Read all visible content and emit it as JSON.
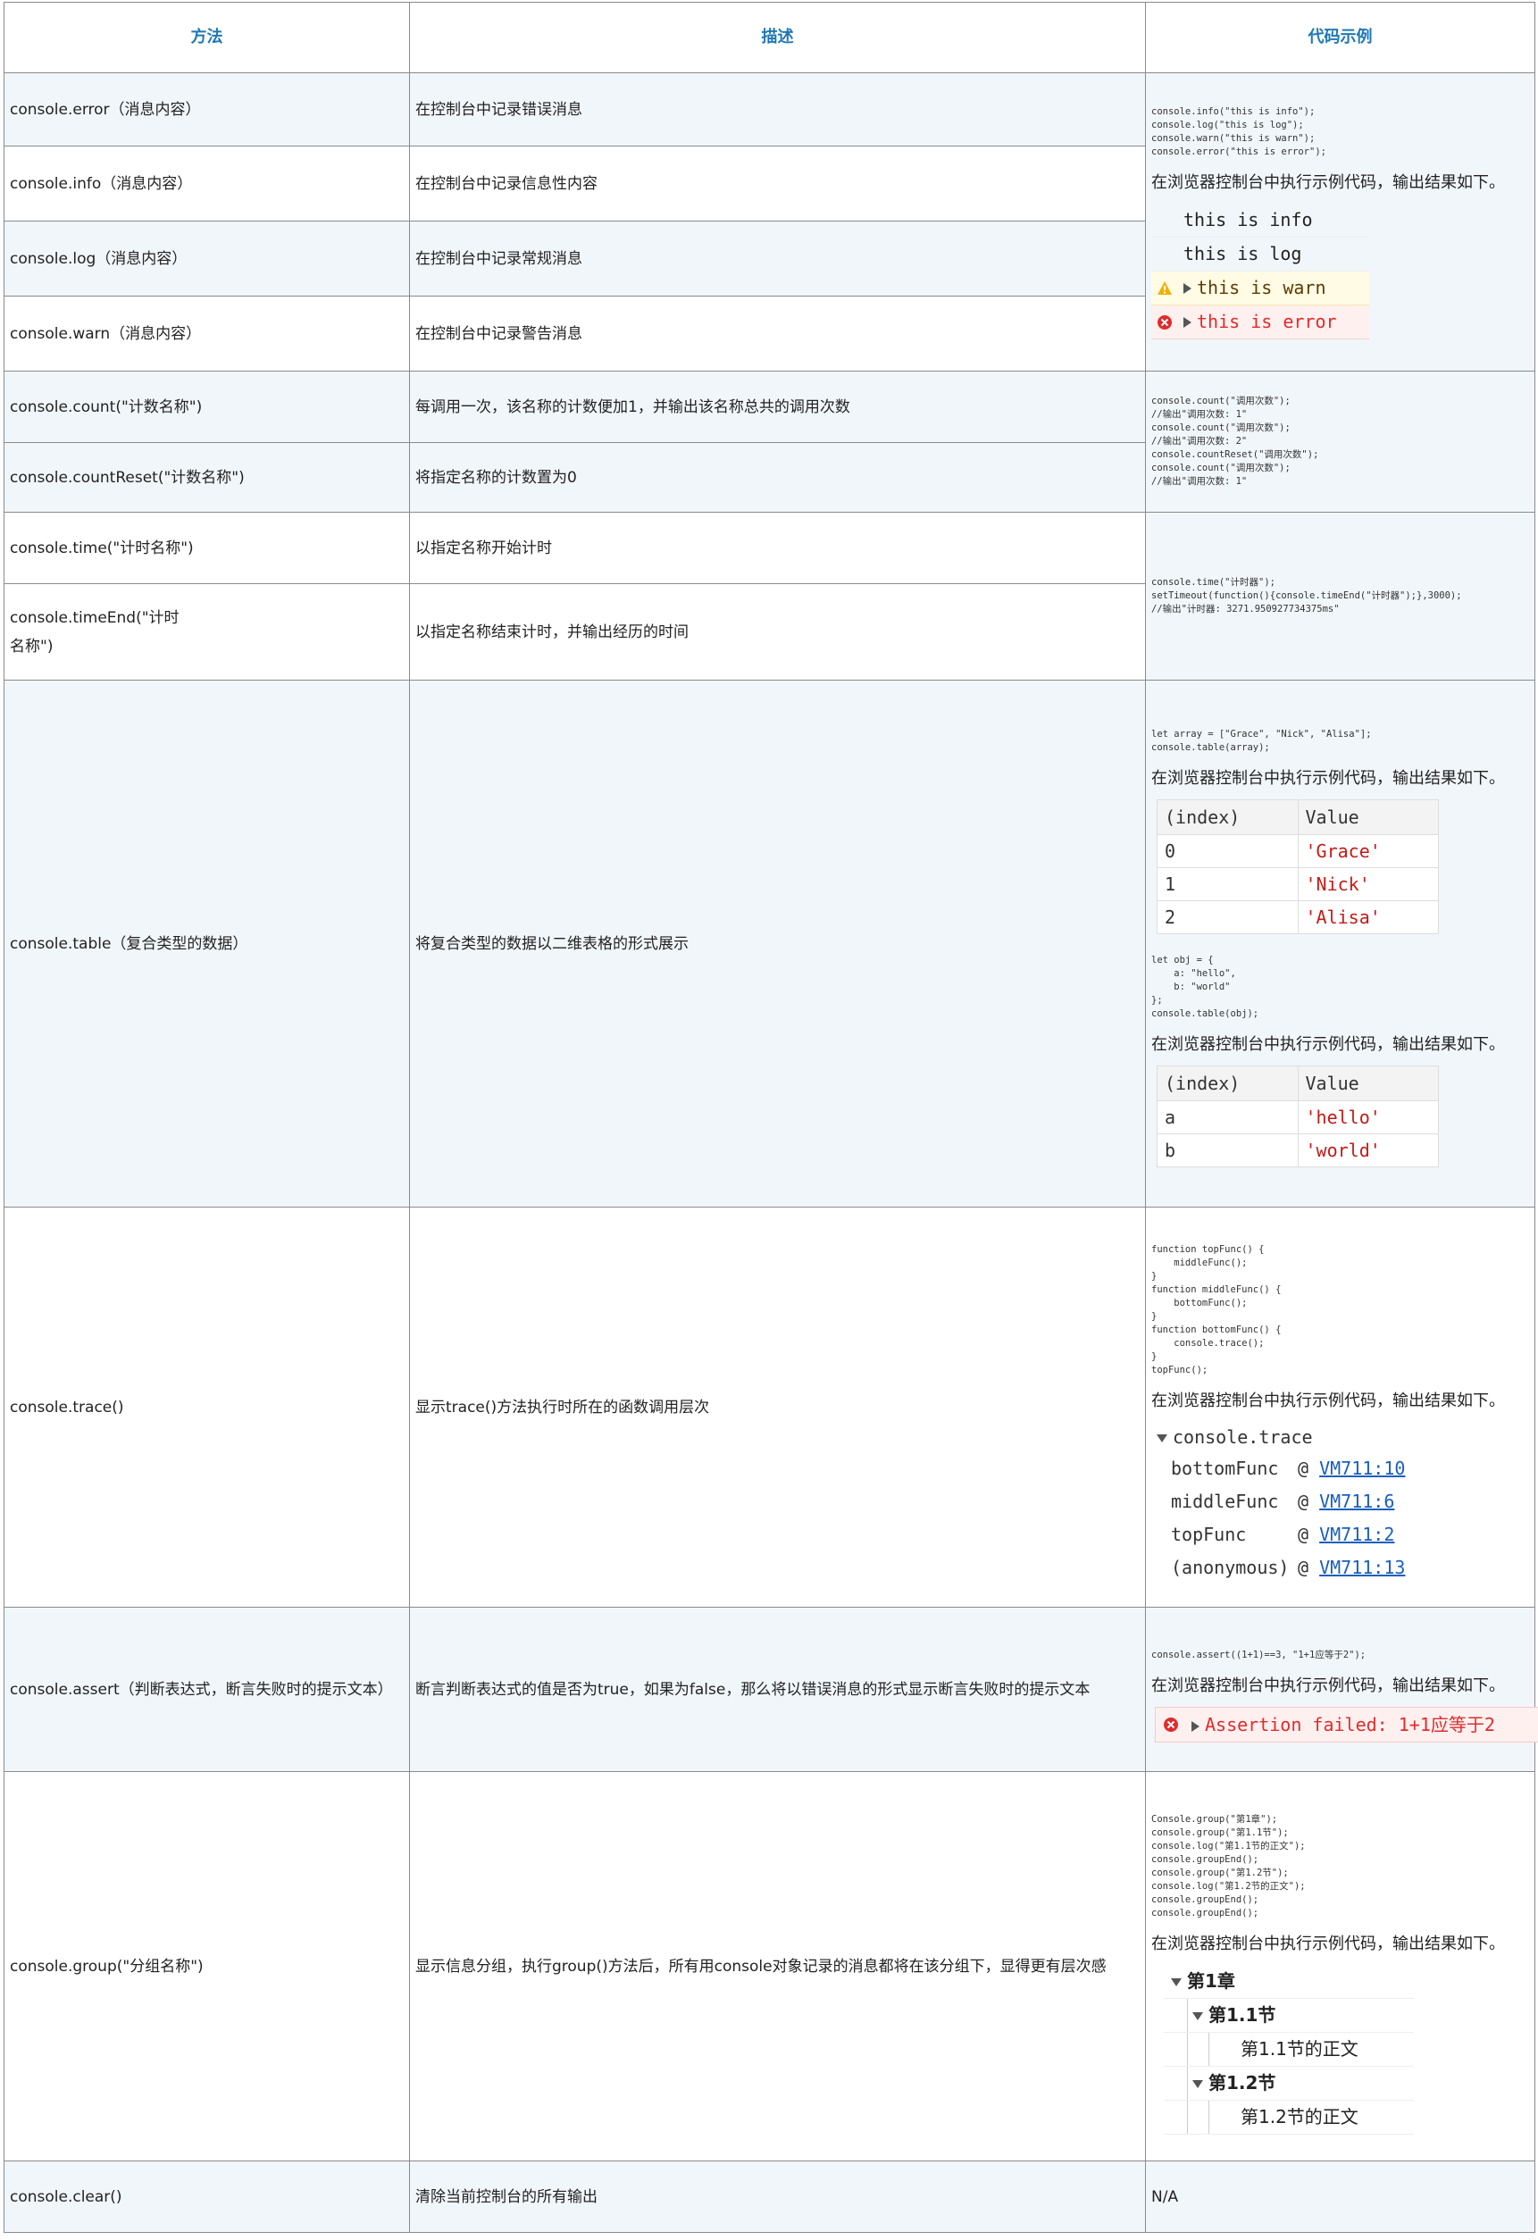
{
  "headers": {
    "method": "方法",
    "desc": "描述",
    "example": "代码示例"
  },
  "note": "在浏览器控制台中执行示例代码，输出结果如下。",
  "rows": {
    "error": {
      "method": "console.error（消息内容）",
      "desc": "在控制台中记录错误消息"
    },
    "info": {
      "method": "console.info（消息内容）",
      "desc": "在控制台中记录信息性内容"
    },
    "log": {
      "method": "console.log（消息内容）",
      "desc": "在控制台中记录常规消息"
    },
    "warn": {
      "method": "console.warn（消息内容）",
      "desc": "在控制台中记录警告消息"
    },
    "count": {
      "method": "console.count(\"计数名称\")",
      "desc": "每调用一次，该名称的计数便加1，并输出该名称总共的调用次数"
    },
    "countReset": {
      "method": "console.countReset(\"计数名称\")",
      "desc": "将指定名称的计数置为0"
    },
    "time": {
      "method": "console.time(\"计时名称\")",
      "desc": "以指定名称开始计时"
    },
    "timeEnd": {
      "method_line1": "console.timeEnd(\"计时",
      "method_line2": "名称\")",
      "desc": "以指定名称结束计时，并输出经历的时间"
    },
    "table": {
      "method": "console.table（复合类型的数据）",
      "desc": "将复合类型的数据以二维表格的形式展示"
    },
    "trace": {
      "method": "console.trace()",
      "desc": "显示trace()方法执行时所在的函数调用层次"
    },
    "assert": {
      "method": "console.assert（判断表达式，断言失败时的提示文本）",
      "desc": "断言判断表达式的值是否为true，如果为false，那么将以错误消息的形式显示断言失败时的提示文本"
    },
    "group": {
      "method": "console.group(\"分组名称\")",
      "desc": "显示信息分组，执行group()方法后，所有用console对象记录的消息都将在该分组下，显得更有层次感"
    },
    "clear": {
      "method": "console.clear()",
      "desc": "清除当前控制台的所有输出",
      "example": "N/A"
    }
  },
  "code": {
    "basic": "console.info(\"this is info\");\nconsole.log(\"this is log\");\nconsole.warn(\"this is warn\");\nconsole.error(\"this is error\");",
    "count": "console.count(\"调用次数\");\n//输出\"调用次数: 1\"\nconsole.count(\"调用次数\");\n//输出\"调用次数: 2\"\nconsole.countReset(\"调用次数\");\nconsole.count(\"调用次数\");\n//输出\"调用次数: 1\"",
    "time": "console.time(\"计时器\");\nsetTimeout(function(){console.timeEnd(\"计时器\");},3000);\n//输出\"计时器: 3271.950927734375ms\"",
    "table1": "let array = [\"Grace\", \"Nick\", \"Alisa\"];\nconsole.table(array);",
    "table2": "let obj = {\n    a: \"hello\",\n    b: \"world\"\n};\nconsole.table(obj);",
    "trace": "function topFunc() {\n    middleFunc();\n}\nfunction middleFunc() {\n    bottomFunc();\n}\nfunction bottomFunc() {\n    console.trace();\n}\ntopFunc();",
    "assert": "console.assert((1+1)==3, \"1+1应等于2\");",
    "group": "Console.group(\"第1章\");\nconsole.group(\"第1.1节\");\nconsole.log(\"第1.1节的正文\");\nconsole.groupEnd();\nconsole.group(\"第1.2节\");\nconsole.log(\"第1.2节的正文\");\nconsole.groupEnd();\nconsole.groupEnd();"
  },
  "console_basic": {
    "info": "this is info",
    "log": "this is log",
    "warn": "this is warn",
    "error": "this is error"
  },
  "table_array": {
    "col_index": "(index)",
    "col_value": "Value",
    "rows": [
      {
        "index": "0",
        "value": "'Grace'"
      },
      {
        "index": "1",
        "value": "'Nick'"
      },
      {
        "index": "2",
        "value": "'Alisa'"
      }
    ]
  },
  "table_obj": {
    "col_index": "(index)",
    "col_value": "Value",
    "rows": [
      {
        "index": "a",
        "value": "'hello'"
      },
      {
        "index": "b",
        "value": "'world'"
      }
    ]
  },
  "trace_out": {
    "header": "console.trace",
    "rows": [
      {
        "fn": "bottomFunc",
        "at": "@",
        "link": "VM711:10"
      },
      {
        "fn": "middleFunc",
        "at": "@",
        "link": "VM711:6"
      },
      {
        "fn": "topFunc",
        "at": "@",
        "link": "VM711:2"
      },
      {
        "fn": "(anonymous)",
        "at": "@",
        "link": "VM711:13"
      }
    ]
  },
  "assert_out": "Assertion failed: 1+1应等于2",
  "group_out": {
    "ch": "第1章",
    "s1": "第1.1节",
    "s1_text": "第1.1节的正文",
    "s2": "第1.2节",
    "s2_text": "第1.2节的正文"
  },
  "colors": {
    "header_text": "#1e78b4",
    "alt_row": "#f1f6fa",
    "error": "#e12b2b",
    "link": "#1a5fbf",
    "string": "#c41a16"
  }
}
